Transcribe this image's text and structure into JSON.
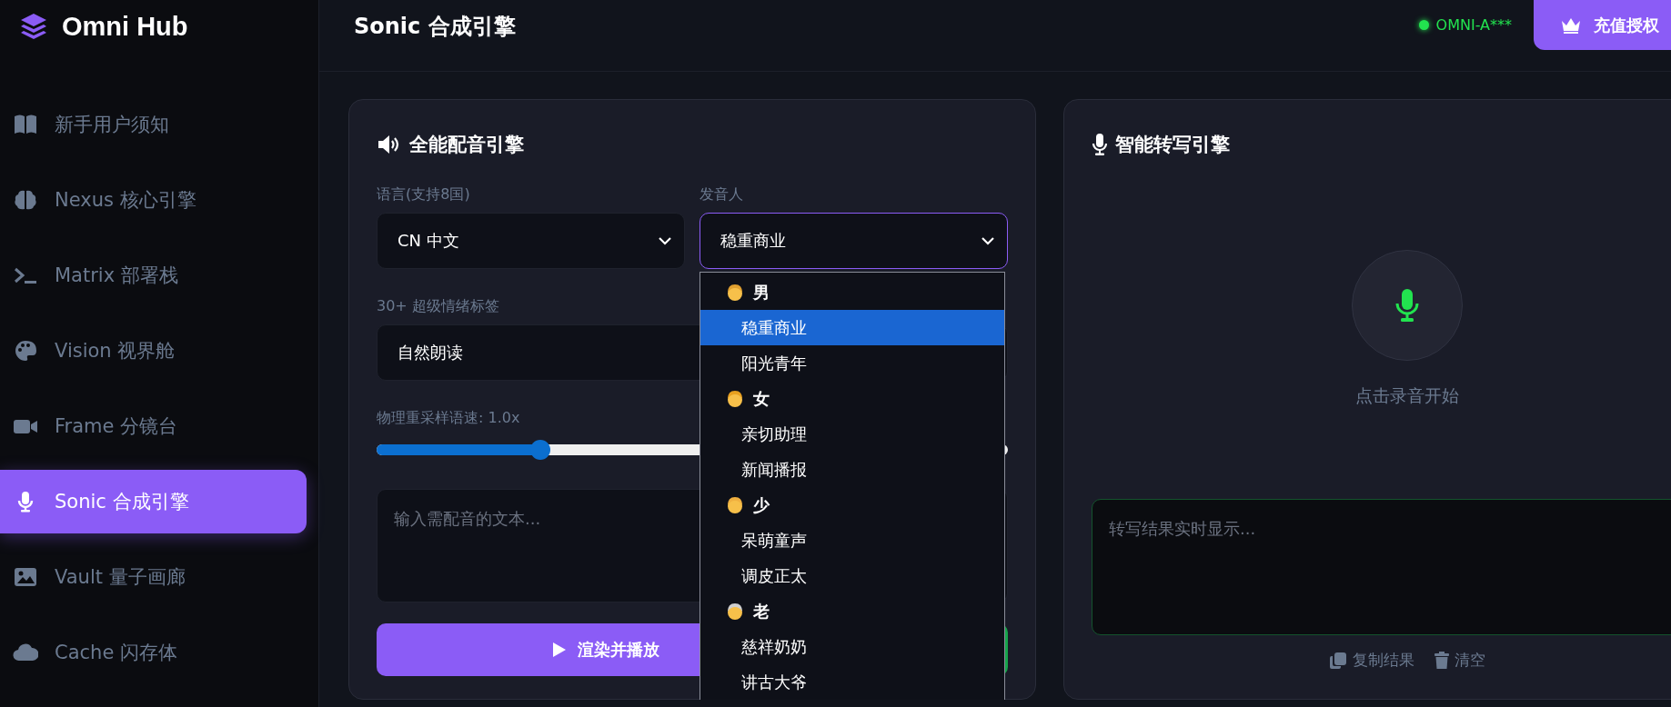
{
  "sidebar": {
    "logo": "Omni Hub",
    "items": [
      {
        "label": "新手用户须知",
        "selected": false
      },
      {
        "label": "Nexus 核心引擎",
        "selected": false
      },
      {
        "label": "Matrix 部署栈",
        "selected": false
      },
      {
        "label": "Vision 视界舱",
        "selected": false
      },
      {
        "label": "Frame 分镜台",
        "selected": false
      },
      {
        "label": "Sonic 合成引擎",
        "selected": true
      },
      {
        "label": "Vault 量子画廊",
        "selected": false
      },
      {
        "label": "Cache 闪存体",
        "selected": false
      }
    ]
  },
  "header": {
    "title": "Sonic 合成引擎",
    "status": "OMNI-A***",
    "upgrade_button": "充值授权"
  },
  "tts_panel": {
    "title": "全能配音引擎",
    "language": {
      "label": "语言(支持8国)",
      "value": "CN 中文"
    },
    "speaker": {
      "label": "发音人",
      "value": "稳重商业",
      "expanded": true
    },
    "emotion": {
      "label": "30+ 超级情绪标签",
      "value": "自然朗读"
    },
    "speed": {
      "label": "物理重采样语速: 1.0x",
      "level": 0.26
    },
    "text_input": {
      "placeholder": "输入需配音的文本..."
    },
    "render_button": "渲染并播放"
  },
  "speaker_dropdown": {
    "groups": [
      {
        "label": "男",
        "options": [
          {
            "label": "稳重商业",
            "selected": true
          },
          {
            "label": "阳光青年",
            "selected": false
          }
        ]
      },
      {
        "label": "女",
        "options": [
          {
            "label": "亲切助理",
            "selected": false
          },
          {
            "label": "新闻播报",
            "selected": false
          }
        ]
      },
      {
        "label": "少",
        "options": [
          {
            "label": "呆萌童声",
            "selected": false
          },
          {
            "label": "调皮正太",
            "selected": false
          }
        ]
      },
      {
        "label": "老",
        "options": [
          {
            "label": "慈祥奶奶",
            "selected": false
          },
          {
            "label": "讲古大爷",
            "selected": false
          }
        ]
      }
    ]
  },
  "stt_panel": {
    "title": "智能转写引擎",
    "record_hint": "点击录音开始",
    "result": {
      "placeholder": "转写结果实时显示..."
    },
    "copy_button": "复制结果",
    "clear_button": "清空"
  }
}
